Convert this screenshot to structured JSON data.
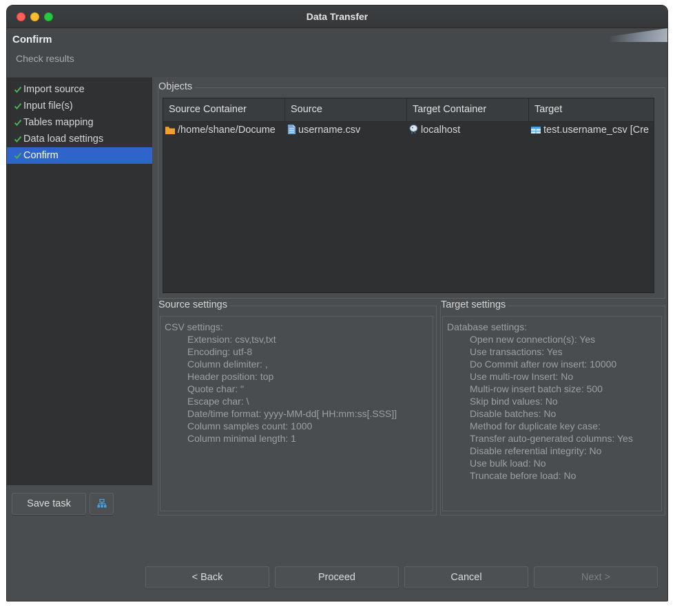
{
  "window": {
    "title": "Data Transfer"
  },
  "header": {
    "title": "Confirm",
    "subtitle": "Check results"
  },
  "nav": {
    "items": [
      {
        "label": "Import source",
        "done": true,
        "selected": false
      },
      {
        "label": "Input file(s)",
        "done": true,
        "selected": false
      },
      {
        "label": "Tables mapping",
        "done": true,
        "selected": false
      },
      {
        "label": "Data load settings",
        "done": true,
        "selected": false
      },
      {
        "label": "Confirm",
        "done": true,
        "selected": true
      }
    ]
  },
  "objects": {
    "legend": "Objects",
    "columns": [
      "Source Container",
      "Source",
      "Target Container",
      "Target"
    ],
    "rows": [
      {
        "source_container": "/home/shane/Docume",
        "source_container_icon": "folder-icon",
        "source": "username.csv",
        "source_icon": "csv-file-icon",
        "target_container": "localhost",
        "target_container_icon": "postgres-elephant-icon",
        "target": "test.username_csv [Cre",
        "target_icon": "table-icon"
      }
    ]
  },
  "source_settings": {
    "legend": "Source settings",
    "heading": "CSV settings:",
    "lines": [
      "Extension: csv,tsv,txt",
      "Encoding: utf-8",
      "Column delimiter: ,",
      "Header position: top",
      "Quote char: \"",
      "Escape char: \\",
      "Date/time format: yyyy-MM-dd[ HH:mm:ss[.SSS]]",
      "Column samples count: 1000",
      "Column minimal length: 1"
    ]
  },
  "target_settings": {
    "legend": "Target settings",
    "heading": "Database settings:",
    "lines": [
      "Open new connection(s): Yes",
      "Use transactions: Yes",
      "Do Commit after row insert: 10000",
      "Use multi-row Insert: No",
      "Multi-row insert batch size: 500",
      "Skip bind values: No",
      "Disable batches: No",
      "Method for duplicate key case:",
      "Transfer auto-generated columns: Yes",
      "Disable referential integrity: No",
      "Use bulk load: No",
      "Truncate before load: No"
    ]
  },
  "buttons": {
    "save_task": "Save task",
    "back": "< Back",
    "proceed": "Proceed",
    "cancel": "Cancel",
    "next": "Next >"
  },
  "colors": {
    "accent": "#2f65ca",
    "check": "#4caf50",
    "folder": "#f0a030",
    "file": "#6fa8dc",
    "table": "#4aa3df"
  }
}
